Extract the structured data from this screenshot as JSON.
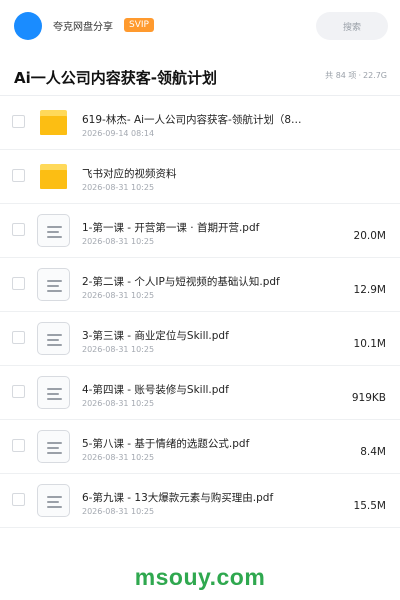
{
  "header": {
    "user_name": "夸克网盘分享",
    "badge": "SVIP",
    "search_placeholder": "搜索"
  },
  "folder": {
    "title": "Ai一人公司内容获客-领航计划",
    "item_count": "共 84 项",
    "total_size": "22.7G"
  },
  "files": [
    {
      "name": "619-林杰- Ai一人公司内容获客-领航计划（8…",
      "date": "2026-09-14 08:14",
      "size": "",
      "type": "folder",
      "icon": "folder-icon"
    },
    {
      "name": "飞书对应的视频资料",
      "date": "2026-08-31 10:25",
      "size": "",
      "type": "folder",
      "icon": "folder-icon"
    },
    {
      "name": "1-第一课 - 开营第一课 · 首期开营.pdf",
      "date": "2026-08-31 10:25",
      "size": "20.0M",
      "type": "file",
      "icon": "document-icon"
    },
    {
      "name": "2-第二课 - 个人IP与短视频的基础认知.pdf",
      "date": "2026-08-31 10:25",
      "size": "12.9M",
      "type": "file",
      "icon": "document-icon"
    },
    {
      "name": "3-第三课 - 商业定位与Skill.pdf",
      "date": "2026-08-31 10:25",
      "size": "10.1M",
      "type": "file",
      "icon": "document-icon"
    },
    {
      "name": "4-第四课 - 账号装修与Skill.pdf",
      "date": "2026-08-31 10:25",
      "size": "919KB",
      "type": "file",
      "icon": "document-icon"
    },
    {
      "name": "5-第八课 - 基于情绪的选题公式.pdf",
      "date": "2026-08-31 10:25",
      "size": "8.4M",
      "type": "file",
      "icon": "document-icon"
    },
    {
      "name": "6-第九课 - 13大爆款元素与购买理由.pdf",
      "date": "2026-08-31 10:25",
      "size": "15.5M",
      "type": "file",
      "icon": "document-icon"
    }
  ],
  "watermark": "msouy.com",
  "colors": {
    "avatar": "#1a8cff",
    "badge": "#ff9a2e",
    "folder": "#fcbe13",
    "watermark": "#2fa84f"
  }
}
